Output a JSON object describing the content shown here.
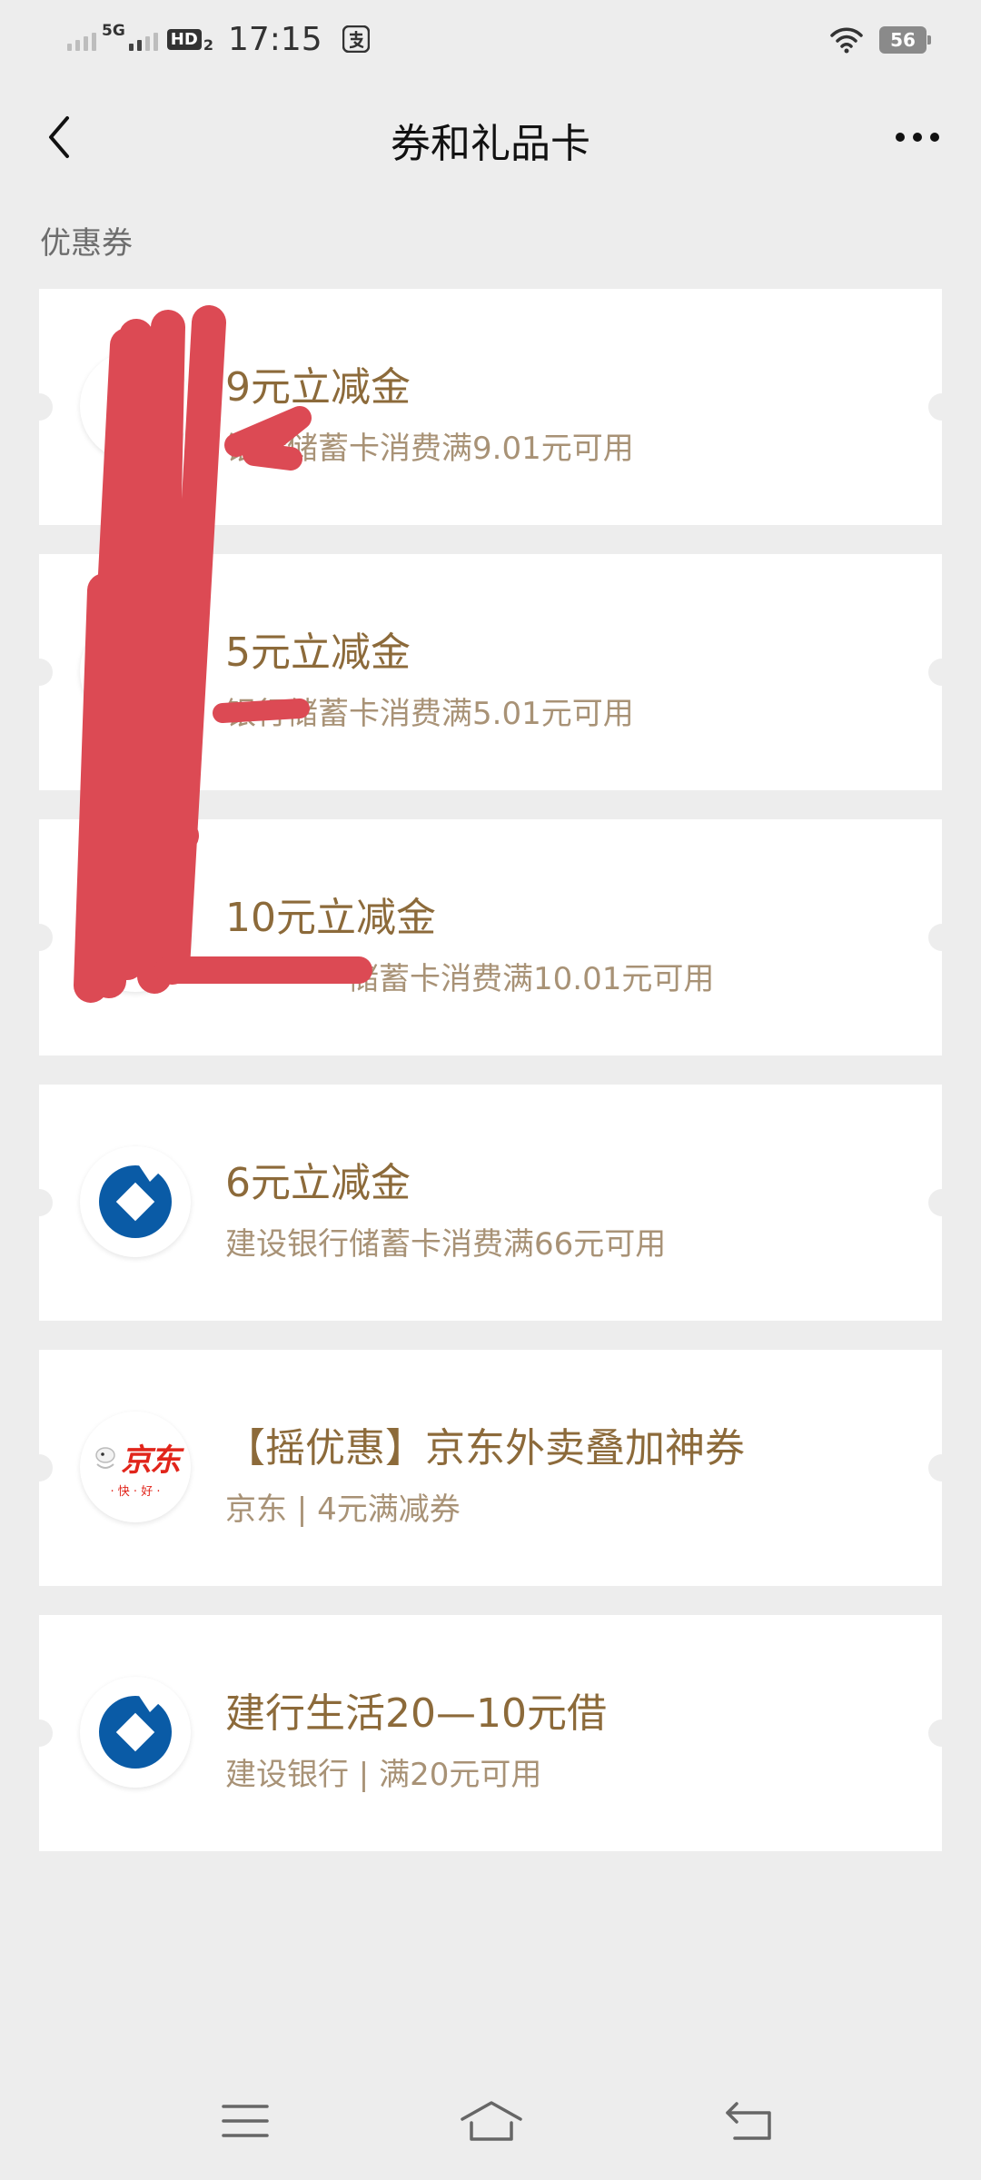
{
  "status_bar": {
    "network": "5G",
    "hd_label": "HD",
    "hd_sub": "2",
    "time": "17:15",
    "battery": "56"
  },
  "nav": {
    "title": "券和礼品卡"
  },
  "section": {
    "label": "优惠券"
  },
  "coupons": [
    {
      "title": "9元立减金",
      "desc": "银行储蓄卡消费满9.01元可用",
      "logo": "bank-logo-icon"
    },
    {
      "title": "5元立减金",
      "desc": "银行储蓄卡消费满5.01元可用",
      "logo": "bank-logo-icon"
    },
    {
      "title": "10元立减金",
      "desc": "储蓄卡消费满10.01元可用",
      "logo": "bank-logo-icon"
    },
    {
      "title": "6元立减金",
      "desc": "建设银行储蓄卡消费满66元可用",
      "logo": "ccb-logo-icon"
    },
    {
      "title": "【摇优惠】京东外卖叠加神券",
      "desc": "京东 | 4元满减券",
      "logo": "jd-logo-icon",
      "logo_text": "京东",
      "logo_sub": "· 快 · 好 ·"
    },
    {
      "title": "建行生活20—10元借",
      "desc": "建设银行 | 满20元可用",
      "logo": "ccb-logo-icon"
    }
  ],
  "colors": {
    "background": "#ededed",
    "coupon_title": "#8c6a3a",
    "coupon_desc": "#a89276",
    "ccb_blue": "#0a5ba6",
    "jd_red": "#e1251b",
    "redaction": "#dc4a54"
  }
}
